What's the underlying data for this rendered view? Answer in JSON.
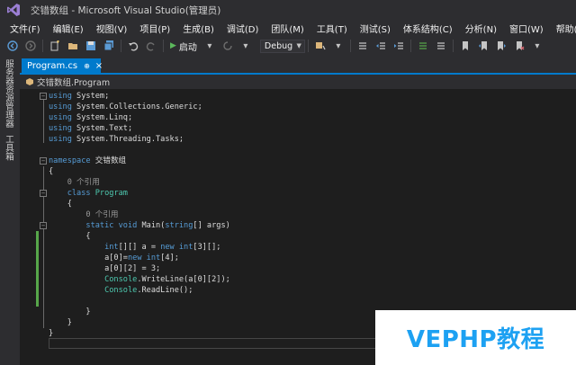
{
  "window": {
    "title": "交错数组 - Microsoft Visual Studio(管理员)"
  },
  "menu": [
    "文件(F)",
    "编辑(E)",
    "视图(V)",
    "项目(P)",
    "生成(B)",
    "调试(D)",
    "团队(M)",
    "工具(T)",
    "测试(S)",
    "体系结构(C)",
    "分析(N)",
    "窗口(W)",
    "帮助(H)"
  ],
  "toolbar": {
    "start_label": "启动",
    "config_value": "Debug"
  },
  "sidebar": {
    "tabs": [
      "服务器资源管理器",
      "工具箱"
    ]
  },
  "document": {
    "tab_label": "Program.cs",
    "pin_glyph": "⊕",
    "close_glyph": "×"
  },
  "navbar": {
    "scope": "交错数组.Program"
  },
  "code": {
    "lines": [
      {
        "t": "using System;"
      },
      {
        "t": "using System.Collections.Generic;"
      },
      {
        "t": "using System.Linq;"
      },
      {
        "t": "using System.Text;"
      },
      {
        "t": "using System.Threading.Tasks;"
      },
      {
        "t": ""
      },
      {
        "t": "namespace 交错数组"
      },
      {
        "t": "{"
      },
      {
        "t": "    0 个引用"
      },
      {
        "t": "    class Program"
      },
      {
        "t": "    {"
      },
      {
        "t": "        0 个引用"
      },
      {
        "t": "        static void Main(string[] args)"
      },
      {
        "t": "        {"
      },
      {
        "t": "            int[][] a = new int[3][];"
      },
      {
        "t": "            a[0]=new int[4];"
      },
      {
        "t": "            a[0][2] = 3;"
      },
      {
        "t": "            Console.WriteLine(a[0][2]);"
      },
      {
        "t": "            Console.ReadLine();"
      },
      {
        "t": ""
      },
      {
        "t": "        }"
      },
      {
        "t": "    }"
      },
      {
        "t": "}"
      }
    ]
  },
  "watermark": {
    "text": "VEPHP教程"
  },
  "colors": {
    "accent": "#007acc",
    "keyword": "#569cd6",
    "type": "#4ec9b0",
    "text": "#dcdcdc",
    "change_marker": "#57a64a"
  }
}
